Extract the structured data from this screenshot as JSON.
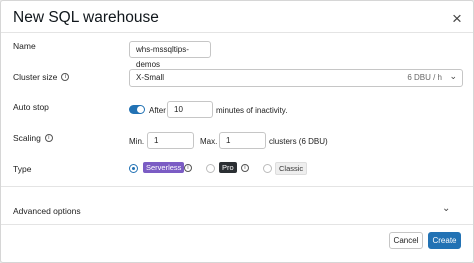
{
  "dialog": {
    "title": "New SQL warehouse",
    "close_glyph": "×"
  },
  "name": {
    "label": "Name",
    "value": "whs-mssqltips-demos"
  },
  "cluster_size": {
    "label": "Cluster size",
    "value": "X-Small",
    "meta": "6 DBU / h",
    "chevron": "⌄"
  },
  "auto_stop": {
    "label": "Auto stop",
    "enabled": true,
    "prefix": "After",
    "value": "10",
    "suffix": "minutes of inactivity."
  },
  "scaling": {
    "label": "Scaling",
    "min_label": "Min.",
    "min_value": "1",
    "max_label": "Max.",
    "max_value": "1",
    "suffix": "clusters (6 DBU)"
  },
  "type": {
    "label": "Type",
    "options": [
      {
        "label": "Serverless",
        "selected": true,
        "badge_color": "#7b5cc4"
      },
      {
        "label": "Pro",
        "selected": false,
        "badge_color": "#2b2f33"
      },
      {
        "label": "Classic",
        "selected": false,
        "badge_color": "#eeeeee"
      }
    ]
  },
  "info_glyph": "i",
  "advanced": {
    "label": "Advanced options",
    "chevron": "⌄"
  },
  "footer": {
    "cancel": "Cancel",
    "create": "Create"
  },
  "colors": {
    "primary": "#2272b4"
  }
}
